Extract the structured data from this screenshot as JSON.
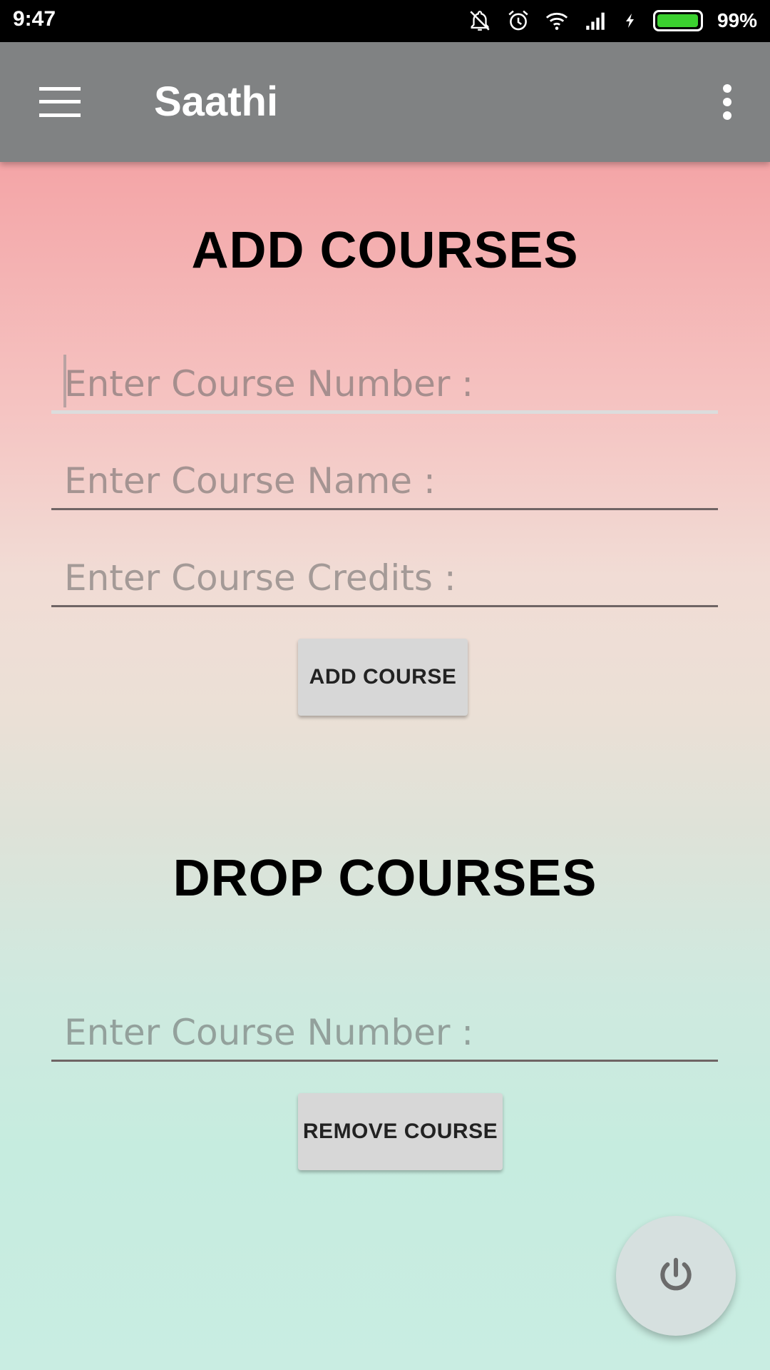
{
  "status_bar": {
    "time": "9:47",
    "battery_percent": "99%",
    "battery_level": 0.99,
    "battery_color": "#3bd02f",
    "icons": [
      "mute-icon",
      "alarm-icon",
      "wifi-icon",
      "signal-icon",
      "charging-icon",
      "battery-icon"
    ]
  },
  "app_bar": {
    "title": "Saathi",
    "background": "#808283",
    "menu_icon": "hamburger-menu-icon",
    "overflow_icon": "more-vert-icon"
  },
  "add_section": {
    "heading": "ADD COURSES",
    "course_number_placeholder": "Enter Course Number :",
    "course_name_placeholder": "Enter Course Name :",
    "course_credits_placeholder": "Enter Course Credits :",
    "button_label": "ADD COURSE"
  },
  "drop_section": {
    "heading": "DROP COURSES",
    "course_number_placeholder": "Enter Course Number :",
    "button_label": "REMOVE COURSE"
  },
  "fab": {
    "icon": "power-icon"
  }
}
